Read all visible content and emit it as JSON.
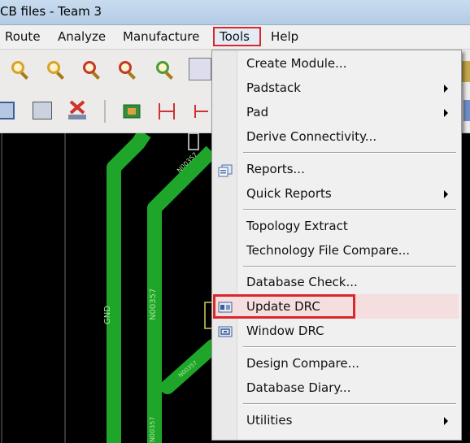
{
  "window": {
    "title": "CB files - Team 3"
  },
  "menubar": {
    "items": [
      {
        "label": "Route"
      },
      {
        "label": "Analyze"
      },
      {
        "label": "Manufacture"
      },
      {
        "label": "Tools",
        "active": true
      },
      {
        "label": "Help"
      }
    ]
  },
  "canvas": {
    "net_labels": [
      "GND",
      "N00357",
      "N00357",
      "N00357",
      "N00357"
    ]
  },
  "tools_menu": {
    "items": [
      {
        "label": "Create Module...",
        "submenu": false
      },
      {
        "label": "Padstack",
        "submenu": true
      },
      {
        "label": "Pad",
        "submenu": true
      },
      {
        "label": "Derive Connectivity...",
        "submenu": false
      },
      {
        "label": "Reports...",
        "submenu": false,
        "icon": "reports-icon"
      },
      {
        "label": "Quick Reports",
        "submenu": true
      },
      {
        "label": "Topology Extract",
        "submenu": false
      },
      {
        "label": "Technology File Compare...",
        "submenu": false
      },
      {
        "label": "Database Check...",
        "submenu": false
      },
      {
        "label": "Update DRC",
        "submenu": false,
        "icon": "update-drc-icon",
        "highlighted": true
      },
      {
        "label": "Window DRC",
        "submenu": false,
        "icon": "window-drc-icon"
      },
      {
        "label": "Design Compare...",
        "submenu": false
      },
      {
        "label": "Database Diary...",
        "submenu": false
      },
      {
        "label": "Utilities",
        "submenu": true
      }
    ]
  },
  "colors": {
    "trace_green": "#1fa52a",
    "highlight_red": "#d9272e",
    "menu_bg": "#f0f0f0"
  }
}
